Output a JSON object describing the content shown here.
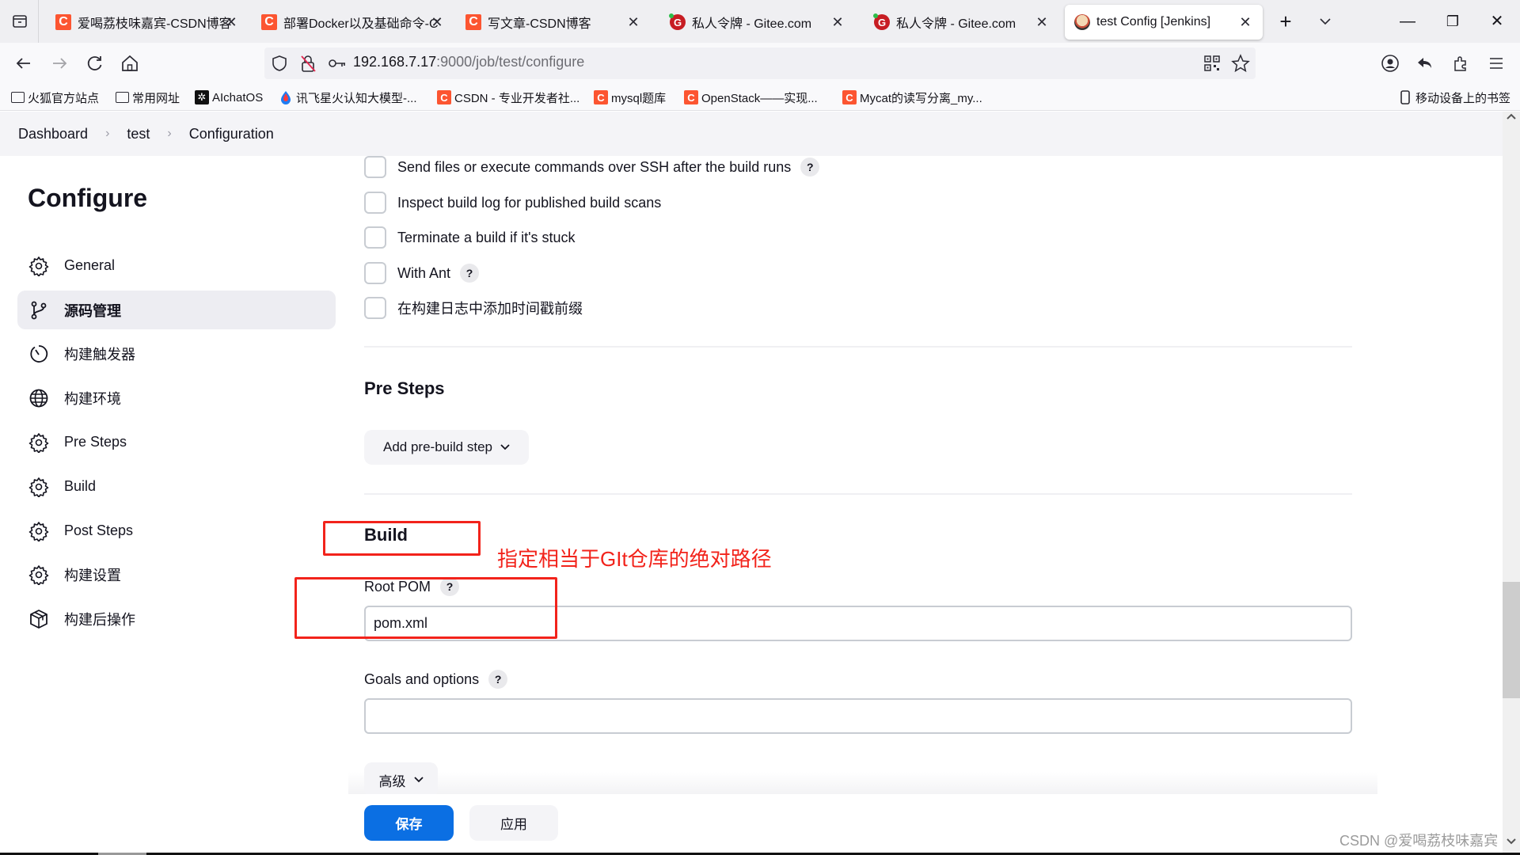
{
  "browser": {
    "tabs": [
      {
        "title": "爱喝荔枝味嘉宾-CSDN博客",
        "favicon": "csdn-icon"
      },
      {
        "title": "部署Docker以及基础命令-C",
        "favicon": "csdn-icon"
      },
      {
        "title": "写文章-CSDN博客",
        "favicon": "csdn-icon"
      },
      {
        "title": "私人令牌 - Gitee.com",
        "favicon": "gitee-icon"
      },
      {
        "title": "私人令牌 - Gitee.com",
        "favicon": "gitee-icon"
      },
      {
        "title": "test Config [Jenkins]",
        "favicon": "jenkins-icon",
        "active": true
      }
    ],
    "close_glyph": "✕",
    "new_tab_glyph": "+",
    "tab_list_glyph": "⌄",
    "window": {
      "minimize": "—",
      "restore": "❐",
      "close": "✕"
    },
    "url": {
      "host": "192.168.7.17",
      "rest": ":9000/job/test/configure"
    },
    "bookmarks": [
      {
        "label": "火狐官方站点",
        "icon": "folder-icon"
      },
      {
        "label": "常用网址",
        "icon": "folder-icon"
      },
      {
        "label": "AIchatOS",
        "icon": "openai-icon"
      },
      {
        "label": "讯飞星火认知大模型-...",
        "icon": "spark-icon"
      },
      {
        "label": "CSDN - 专业开发者社...",
        "icon": "csdn-icon"
      },
      {
        "label": "mysql题库",
        "icon": "csdn-icon"
      },
      {
        "label": "OpenStack——实现...",
        "icon": "csdn-icon"
      },
      {
        "label": "Mycat的读写分离_my...",
        "icon": "csdn-icon"
      }
    ],
    "mobile_bookmarks": "移动设备上的书签",
    "csdn_letter": "C",
    "gitee_letter": "G"
  },
  "breadcrumb": [
    "Dashboard",
    "test",
    "Configuration"
  ],
  "breadcrumb_sep": "›",
  "sidebar": {
    "title": "Configure",
    "items": [
      {
        "label": "General",
        "icon": "gear-icon"
      },
      {
        "label": "源码管理",
        "icon": "branch-icon",
        "active": true
      },
      {
        "label": "构建触发器",
        "icon": "clock-icon"
      },
      {
        "label": "构建环境",
        "icon": "globe-icon"
      },
      {
        "label": "Pre Steps",
        "icon": "gear-icon"
      },
      {
        "label": "Build",
        "icon": "gear-icon"
      },
      {
        "label": "Post Steps",
        "icon": "gear-icon"
      },
      {
        "label": "构建设置",
        "icon": "gear-icon"
      },
      {
        "label": "构建后操作",
        "icon": "package-icon"
      }
    ]
  },
  "build_env_options": [
    {
      "label": "Send files or execute commands over SSH after the build runs",
      "checked": false,
      "help": true
    },
    {
      "label": "Inspect build log for published build scans",
      "checked": false,
      "help": false
    },
    {
      "label": "Terminate a build if it's stuck",
      "checked": false,
      "help": false
    },
    {
      "label": "With Ant",
      "checked": false,
      "help": true
    },
    {
      "label": "在构建日志中添加时间戳前缀",
      "checked": false,
      "help": false
    }
  ],
  "help_glyph": "?",
  "pre_steps": {
    "heading": "Pre Steps",
    "add_button": "Add pre-build step"
  },
  "build": {
    "heading": "Build",
    "root_pom": {
      "label": "Root POM",
      "value": "pom.xml"
    },
    "goals": {
      "label": "Goals and options",
      "value": ""
    },
    "advanced_button": "高级"
  },
  "chevron_glyph": "⌄",
  "footer": {
    "save": "保存",
    "apply": "应用"
  },
  "annotation": {
    "text": "指定相当于GIt仓库的绝对路径",
    "color": "#f2231b"
  },
  "watermark": "CSDN @爱喝荔枝味嘉宾",
  "colors": {
    "primary": "#0b6fe3",
    "annotation_red": "#f2231b",
    "csdn": "#fc5531",
    "gitee": "#c71d23"
  }
}
